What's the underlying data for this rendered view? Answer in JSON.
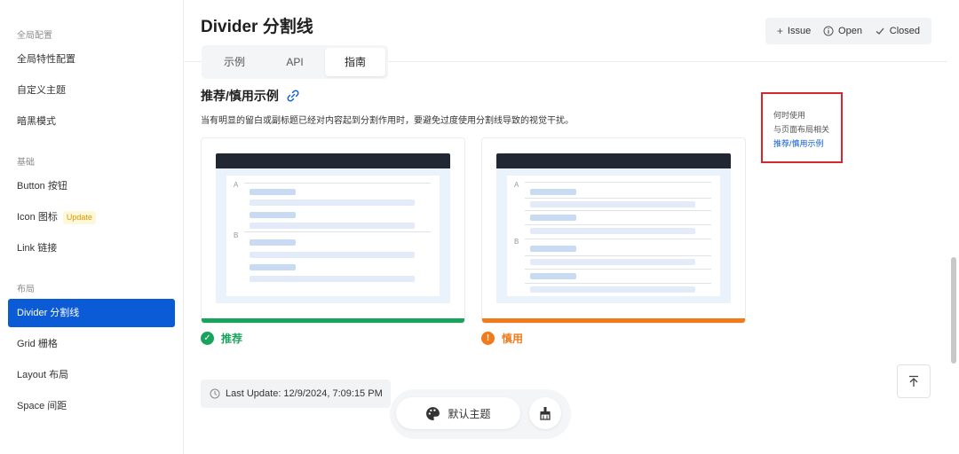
{
  "sidebar": {
    "groups": {
      "global": "全局配置",
      "basic": "基础",
      "layout": "布局"
    },
    "items": {
      "global_feature": "全局特性配置",
      "custom_theme": "自定义主题",
      "dark_mode": "暗黑模式",
      "button": "Button 按钮",
      "icon": "Icon 图标",
      "icon_tag": "Update",
      "link": "Link 链接",
      "divider": "Divider 分割线",
      "grid": "Grid 栅格",
      "layout": "Layout 布局",
      "space": "Space 间距"
    }
  },
  "header": {
    "title": "Divider 分割线",
    "tabs": [
      "示例",
      "API",
      "指南"
    ],
    "active_tab": "指南",
    "issue_bar": {
      "issue": "Issue",
      "open": "Open",
      "closed": "Closed"
    }
  },
  "section": {
    "title": "推荐/慎用示例",
    "description": "当有明显的留白或副标题已经对内容起到分割作用时，要避免过度使用分割线导致的视觉干扰。",
    "cards": {
      "recommend": {
        "label": "推荐",
        "letter_a": "A",
        "letter_b": "B",
        "stripe_color": "#1aa35c"
      },
      "caution": {
        "label": "慎用",
        "letter_a": "A",
        "letter_b": "B",
        "stripe_color": "#f07b1d"
      }
    }
  },
  "toc": {
    "items": [
      "何时使用",
      "与页面布局相关",
      "推荐/慎用示例"
    ],
    "active": "推荐/慎用示例"
  },
  "footer": {
    "last_update": "Last Update: 12/9/2024, 7:09:15 PM",
    "theme_button": "默认主题"
  },
  "colors": {
    "accent": "#0b5ad6",
    "recommend": "#1aa35c",
    "caution": "#f07b1d",
    "toc_border": "#d9262c"
  },
  "icons": {
    "link": "link-icon",
    "check": "check-circle-icon",
    "warning": "warning-circle-icon",
    "clock": "clock-icon",
    "palette": "palette-icon",
    "brush": "brush-icon",
    "to_top": "arrow-up-icon"
  }
}
